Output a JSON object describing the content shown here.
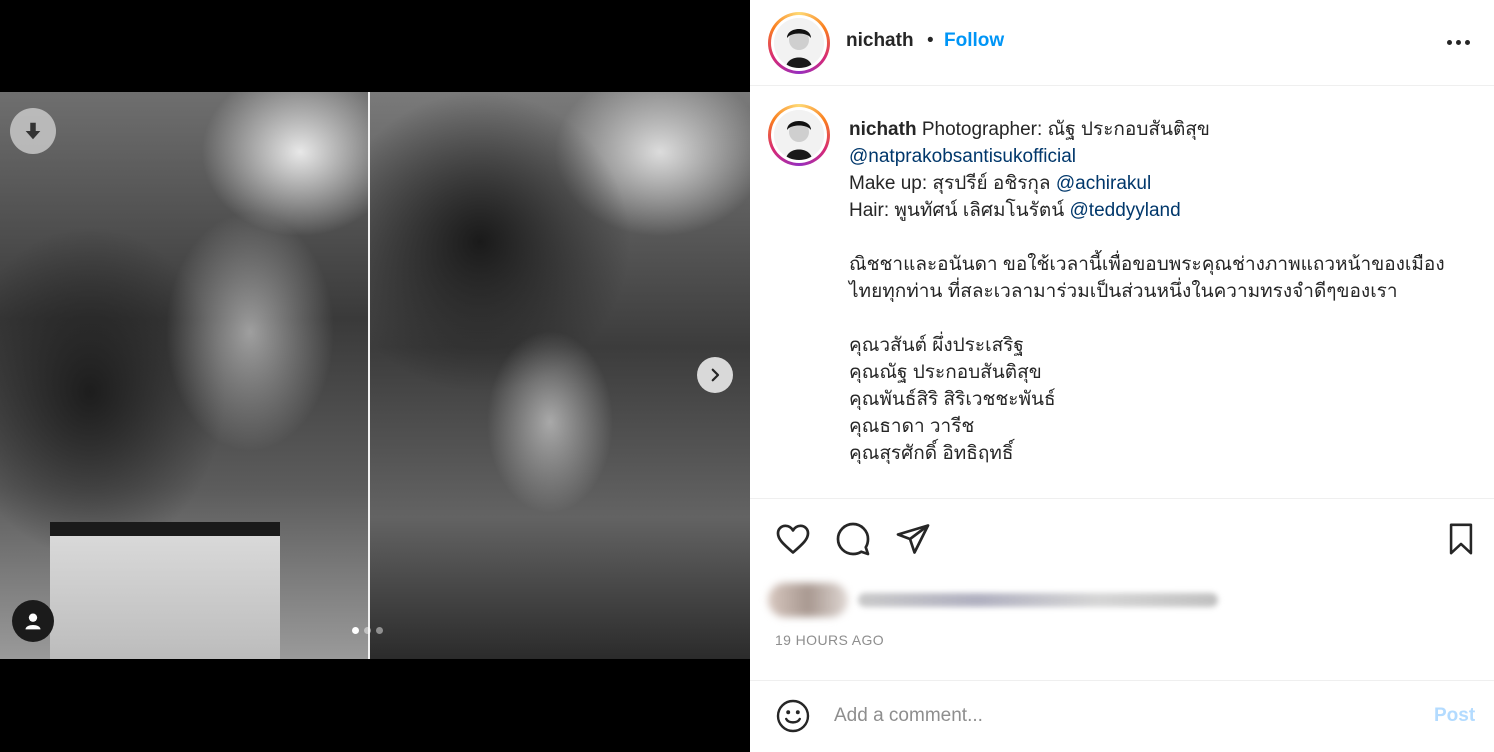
{
  "post": {
    "username": "nichath",
    "separator": "•",
    "follow_label": "Follow",
    "more_icon": "more-options-icon",
    "carousel": {
      "slide_count": 3,
      "active_slide": 1
    },
    "caption": {
      "username": "nichath",
      "line1_text": " Photographer: ณัฐ ประกอบสันติสุข",
      "line2_mention": "@natprakobsantisukofficial",
      "line3_text": "Make up: สุรปรีย์ อชิรกุล ",
      "line3_mention": "@achirakul",
      "line4_text": "Hair: พูนทัศน์ เลิศมโนรัตน์ ",
      "line4_mention": "@teddyyland",
      "para1": "ณิชชาและอนันดา ขอใช้เวลานี้เพื่อขอบพระคุณช่างภาพแถวหน้าของเมืองไทยทุกท่าน ที่สละเวลามาร่วมเป็นส่วนหนึ่งในความทรงจำดีๆของเรา",
      "names": [
        "คุณวสันต์ ผึ่งประเสริฐ",
        "คุณณัฐ ประกอบสันติสุข",
        "คุณพันธ์สิริ สิริเวชชะพันธ์",
        "คุณธาดา วารีช",
        "คุณสุรศักดิ์ อิทธิฤทธิ์"
      ]
    },
    "timestamp": "19 HOURS AGO",
    "comment": {
      "placeholder": "Add a comment...",
      "post_label": "Post"
    }
  },
  "colors": {
    "follow": "#0095f6",
    "mention": "#00376b",
    "muted": "#8e8e8e",
    "post_disabled": "#b3dbff"
  }
}
